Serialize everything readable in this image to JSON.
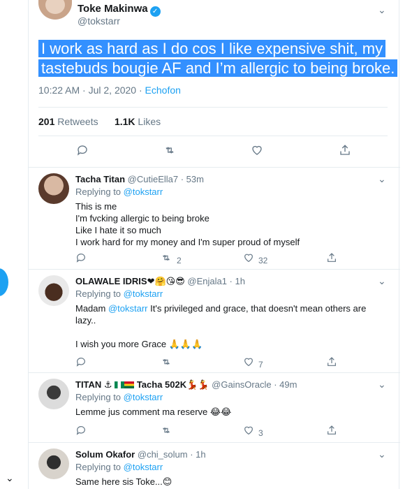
{
  "main_tweet": {
    "name": "Toke Makinwa",
    "handle": "@tokstarr",
    "text_line1": "I work as hard as I do cos I like expensive shit, my",
    "text_line2": "tastebuds bougie AF and I’m allergic to being broke.",
    "timestamp": "10:22 AM · Jul 2, 2020 · ",
    "source": "Echofon",
    "retweets_count": "201",
    "retweets_label": "Retweets",
    "likes_count": "1.1K",
    "likes_label": "Likes"
  },
  "replies": [
    {
      "name": "Tacha Titan",
      "handle": "@CutieElla7 · 53m",
      "replying_label": "Replying to ",
      "replying_to": "@tokstarr",
      "lines": [
        "This is me",
        "I'm fvcking allergic to being broke",
        "Like I hate it so much",
        "I work hard for my money and I'm super proud of myself"
      ],
      "retweets": "2",
      "likes": "32"
    },
    {
      "name": "OLAWALE IDRIS",
      "name_emoji": "❤🤗😘😎",
      "handle": "@Enjala1 · 1h",
      "replying_label": "Replying to ",
      "replying_to": "@tokstarr",
      "body_prefix": "Madam ",
      "body_mention": "@tokstarr",
      "body_rest": " It's privileged and grace, that doesn't mean others are",
      "body_line2": "lazy..",
      "body_line3": "I wish you more Grace 🙏🙏🙏",
      "retweets": "",
      "likes": "7"
    },
    {
      "name": "TITAN",
      "name_mid": " ⚓",
      "name_tail": " Tacha 502K💃💃",
      "handle": "@GainsOracle · 49m",
      "replying_label": "Replying to ",
      "replying_to": "@tokstarr",
      "body": "Lemme jus comment ma reserve 😂😂",
      "retweets": "",
      "likes": "3"
    },
    {
      "name": "Solum Okafor",
      "handle": "@chi_solum · 1h",
      "replying_label": "Replying to ",
      "replying_to": "@tokstarr",
      "body": "Same here sis Toke...😊"
    }
  ],
  "icons": {
    "reply": "reply-icon",
    "retweet": "retweet-icon",
    "like": "heart-icon",
    "share": "share-icon",
    "more": "chevron-down-icon"
  },
  "colors": {
    "accent": "#1da1f2",
    "selection": "#3390ff",
    "muted": "#657786"
  }
}
